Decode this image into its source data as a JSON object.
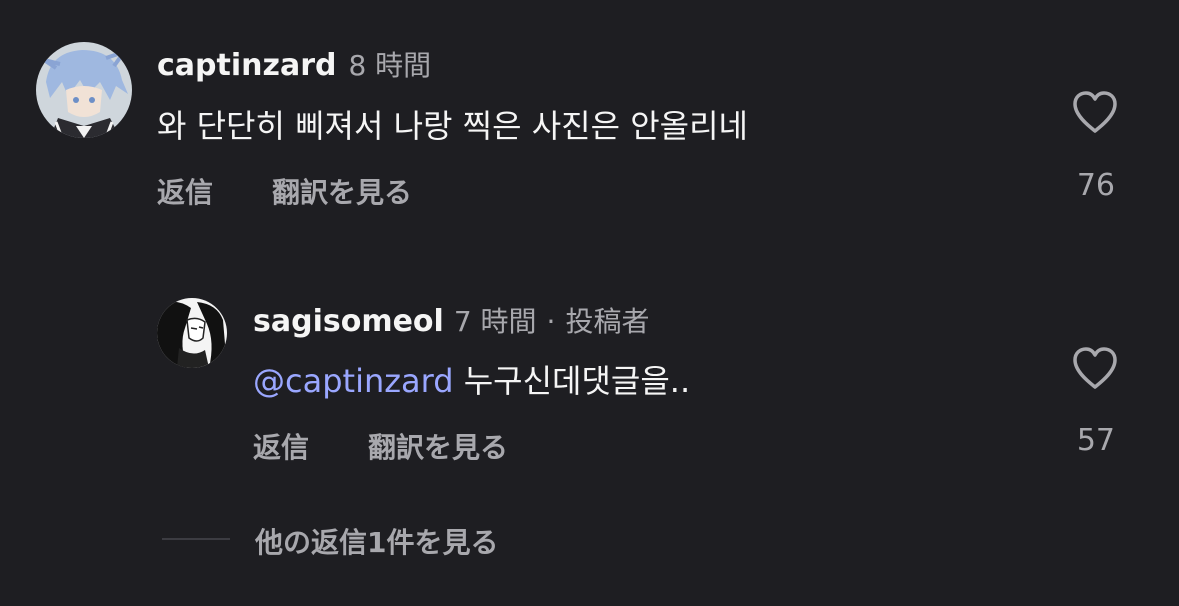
{
  "comments": [
    {
      "username": "captinzard",
      "time": "8 時間",
      "text": "와 단단히 삐져서 나랑 찍은 사진은 안올리네",
      "reply_label": "返信",
      "translate_label": "翻訳を見る",
      "likes": "76"
    }
  ],
  "reply": {
    "username": "sagisomeol",
    "time": "7 時間",
    "separator": "·",
    "author_badge": "投稿者",
    "mention": "@captinzard",
    "text": " 누구신데댓글을..",
    "reply_label": "返信",
    "translate_label": "翻訳を見る",
    "likes": "57"
  },
  "view_more_replies": "他の返信1件を見る",
  "colors": {
    "background": "#1e1e22",
    "mention": "#9aa7ff",
    "secondary_text": "#a8a8ad"
  }
}
